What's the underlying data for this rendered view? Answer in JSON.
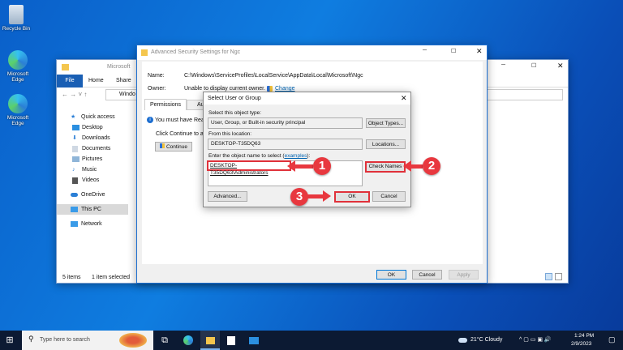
{
  "desktop": {
    "icons": [
      {
        "label": "Recycle Bin"
      },
      {
        "label": "Microsoft Edge"
      },
      {
        "label": "Microsoft Edge"
      }
    ]
  },
  "explorer": {
    "title": "Microsoft",
    "ribbon_tabs": [
      "File",
      "Home",
      "Share"
    ],
    "address": "Windo",
    "nav": [
      {
        "label": "Quick access",
        "icon": "star-icon"
      },
      {
        "label": "Desktop",
        "icon": "desktop-icon"
      },
      {
        "label": "Downloads",
        "icon": "download-icon"
      },
      {
        "label": "Documents",
        "icon": "document-icon"
      },
      {
        "label": "Pictures",
        "icon": "picture-icon"
      },
      {
        "label": "Music",
        "icon": "music-icon"
      },
      {
        "label": "Videos",
        "icon": "video-icon"
      },
      {
        "label": "OneDrive",
        "icon": "cloud-icon"
      },
      {
        "label": "This PC",
        "icon": "pc-icon"
      },
      {
        "label": "Network",
        "icon": "network-icon"
      }
    ],
    "status_items": "5 items",
    "status_selected": "1 item selected"
  },
  "adv": {
    "title": "Advanced Security Settings for Ngc",
    "name_label": "Name:",
    "name_value": "C:\\Windows\\ServiceProfiles\\LocalService\\AppData\\Local\\Microsoft\\Ngc",
    "owner_label": "Owner:",
    "owner_value": "Unable to display current owner.",
    "change_link": "Change",
    "tabs": [
      "Permissions",
      "Au"
    ],
    "info": "You must have Read",
    "continue_text": "Click Continue to at",
    "continue_btn": "Continue",
    "ok": "OK",
    "cancel": "Cancel",
    "apply": "Apply"
  },
  "dialog": {
    "title": "Select User or Group",
    "type_label": "Select this object type:",
    "type_value": "User, Group, or Built-in security principal",
    "object_types_btn": "Object Types...",
    "location_label": "From this location:",
    "location_value": "DESKTOP-T35DQ63",
    "locations_btn": "Locations...",
    "enter_label": "Enter the object name to select (",
    "examples_link": "examples",
    "enter_label_end": "):",
    "object_name": "DESKTOP-T35DQ63\\Administrators",
    "check_names_btn": "Check Names",
    "advanced_btn": "Advanced...",
    "ok_btn": "OK",
    "cancel_btn": "Cancel"
  },
  "steps": [
    "1",
    "2",
    "3"
  ],
  "taskbar": {
    "search_placeholder": "Type here to search",
    "weather": "21°C  Cloudy",
    "time": "1:24 PM",
    "date": "2/9/2023"
  },
  "colors": {
    "highlight": "#e0313a",
    "accent": "#0063b1"
  }
}
